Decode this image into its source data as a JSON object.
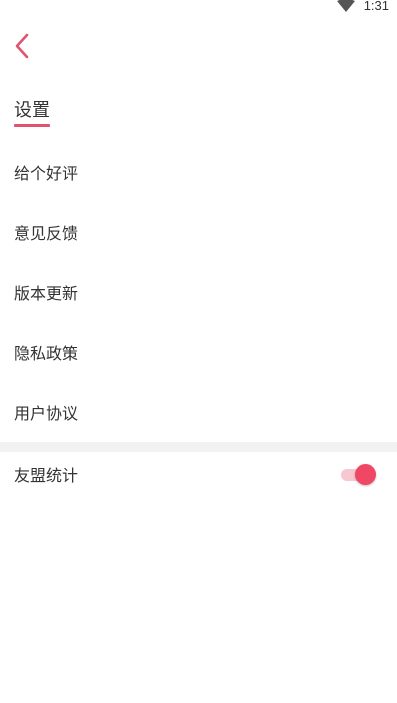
{
  "status_bar": {
    "time": "1:31",
    "wifi_icon": "wifi-icon"
  },
  "header": {
    "back_icon": "chevron-left-icon",
    "title": "设置"
  },
  "menu": {
    "items": [
      {
        "label": "给个好评"
      },
      {
        "label": "意见反馈"
      },
      {
        "label": "版本更新"
      },
      {
        "label": "隐私政策"
      },
      {
        "label": "用户协议"
      }
    ]
  },
  "analytics": {
    "label": "友盟统计",
    "enabled": true
  },
  "colors": {
    "accent": "#ef4764",
    "underline": "#e0546f",
    "toggle_track": "#f7c8d0",
    "divider": "#f2f2f2",
    "text": "#333333"
  }
}
